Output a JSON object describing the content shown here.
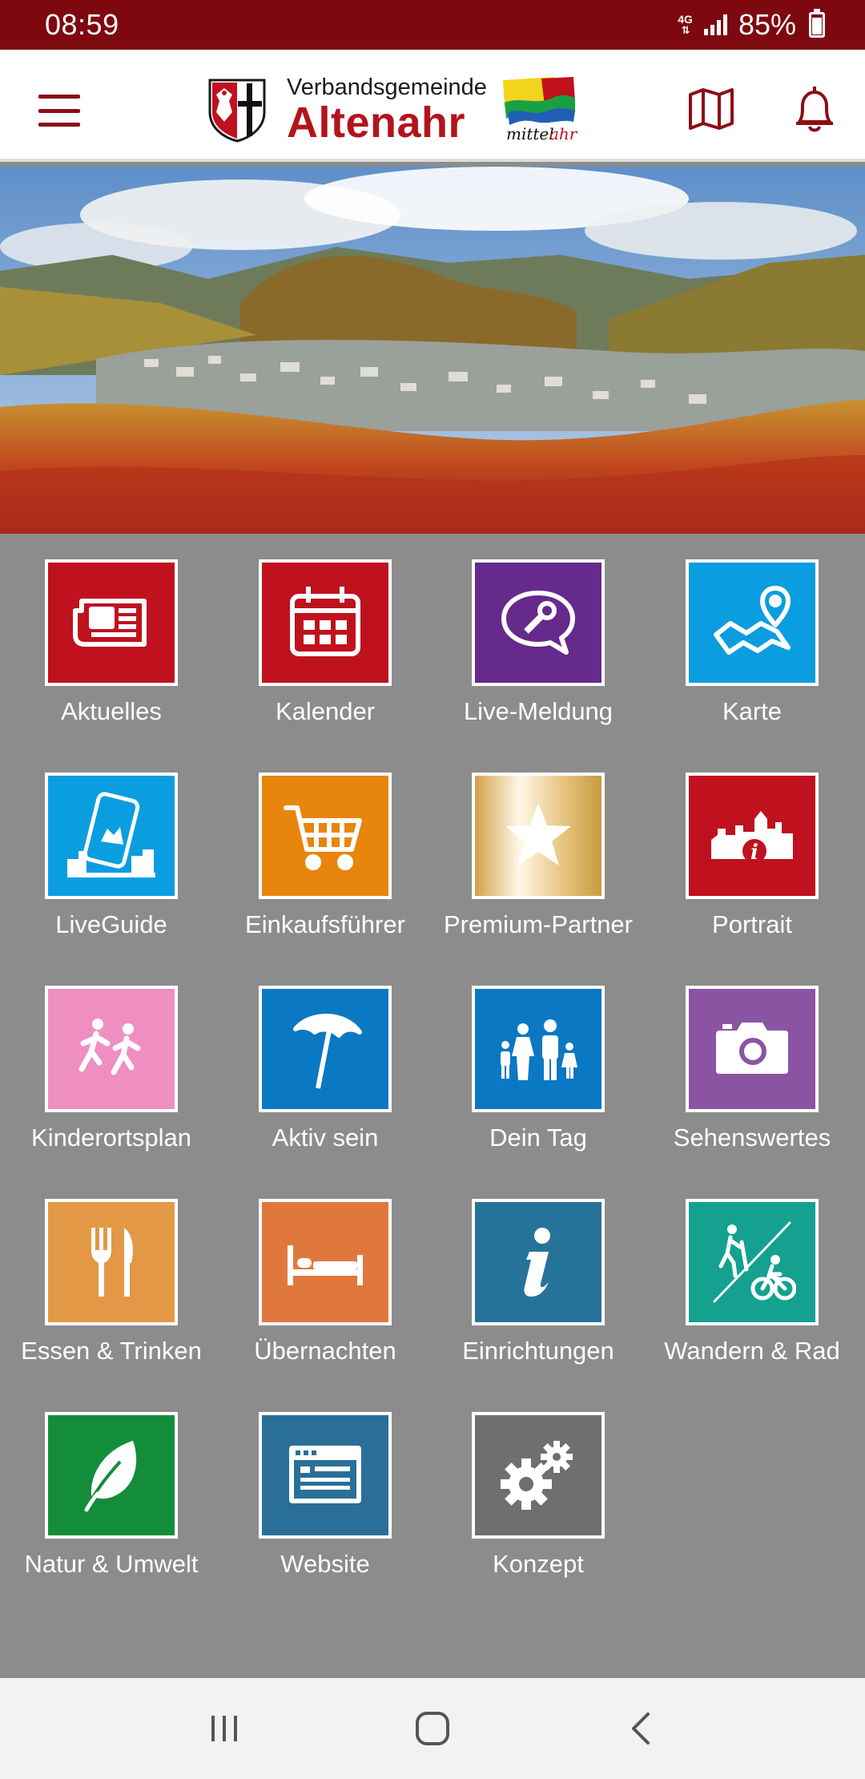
{
  "status_bar": {
    "time": "08:59",
    "network": "4G",
    "battery": "85%"
  },
  "header": {
    "logo_line1": "Verbandsgemeinde",
    "logo_line2": "Altenahr",
    "logo_badge_text": "mittelahr",
    "colors": {
      "brand": "#b3141c",
      "status_bar": "#7e0810"
    }
  },
  "tiles": [
    {
      "label": "Aktuelles",
      "color": "#c0111e",
      "icon": "newspaper-icon"
    },
    {
      "label": "Kalender",
      "color": "#c0111e",
      "icon": "calendar-icon"
    },
    {
      "label": "Live-Meldung",
      "color": "#652a8c",
      "icon": "wrench-chat-icon"
    },
    {
      "label": "Karte",
      "color": "#0a9ee0",
      "icon": "map-pin-icon"
    },
    {
      "label": "LiveGuide",
      "color": "#0a9ee0",
      "icon": "phone-city-icon"
    },
    {
      "label": "Einkaufsführer",
      "color": "#e8850c",
      "icon": "cart-icon"
    },
    {
      "label": "Premium-Partner",
      "color": "#d8b46a",
      "icon": "star-icon"
    },
    {
      "label": "Portrait",
      "color": "#c0111e",
      "icon": "town-info-icon"
    },
    {
      "label": "Kinderortsplan",
      "color": "#ef8fc1",
      "icon": "children-running-icon"
    },
    {
      "label": "Aktiv sein",
      "color": "#0b78c4",
      "icon": "beach-umbrella-icon"
    },
    {
      "label": "Dein Tag",
      "color": "#0b78c4",
      "icon": "family-icon"
    },
    {
      "label": "Sehenswertes",
      "color": "#8a54a3",
      "icon": "camera-icon"
    },
    {
      "label": "Essen & Trinken",
      "color": "#e29845",
      "icon": "fork-knife-icon"
    },
    {
      "label": "Übernachten",
      "color": "#e0783e",
      "icon": "bed-icon"
    },
    {
      "label": "Einrichtungen",
      "color": "#26739a",
      "icon": "info-icon"
    },
    {
      "label": "Wandern & Rad",
      "color": "#14a18f",
      "icon": "hike-bike-icon"
    },
    {
      "label": "Natur & Umwelt",
      "color": "#138d3a",
      "icon": "leaf-icon"
    },
    {
      "label": "Website",
      "color": "#2a6f98",
      "icon": "browser-icon"
    },
    {
      "label": "Konzept",
      "color": "#6f6f6f",
      "icon": "gears-icon"
    }
  ]
}
